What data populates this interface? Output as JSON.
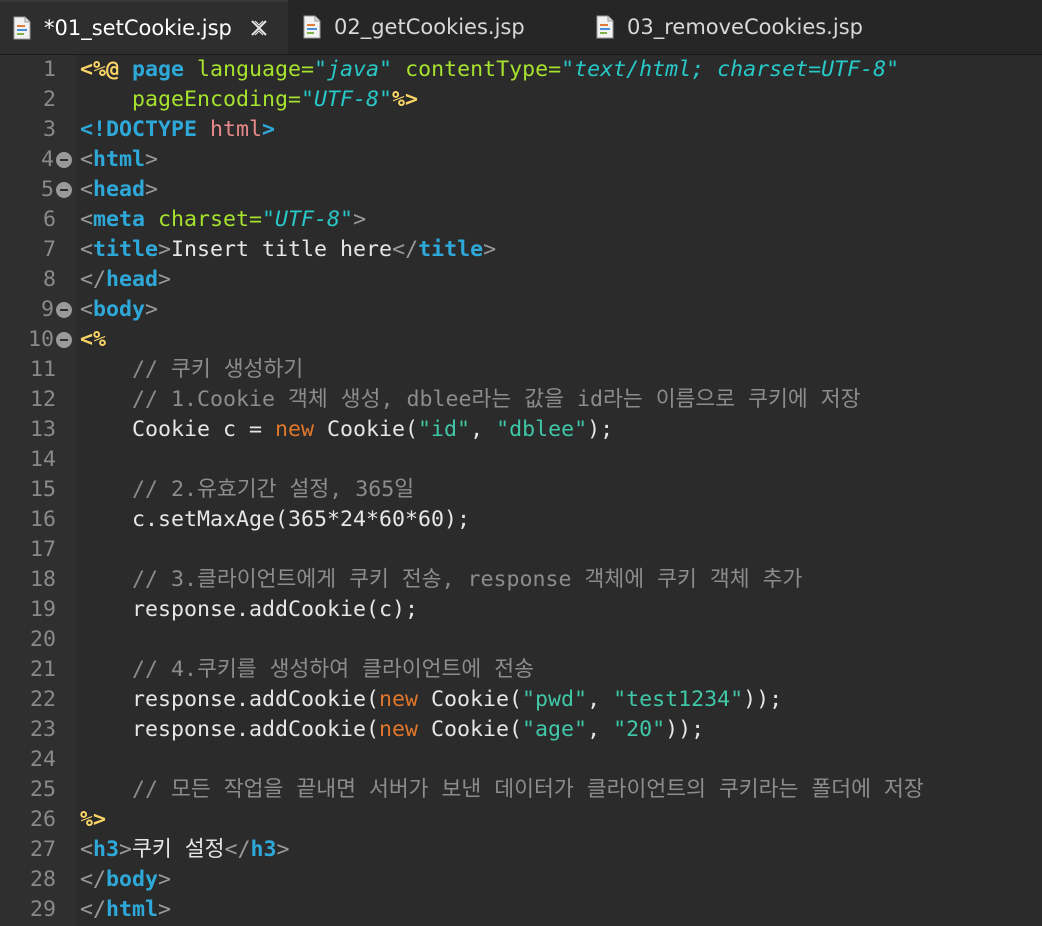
{
  "tabs": [
    {
      "label": "*01_setCookie.jsp",
      "active": true
    },
    {
      "label": "02_getCookies.jsp",
      "active": false
    },
    {
      "label": "03_removeCookies.jsp",
      "active": false
    }
  ],
  "line_numbers": [
    "1",
    "2",
    "3",
    "4",
    "5",
    "6",
    "7",
    "8",
    "9",
    "10",
    "11",
    "12",
    "13",
    "14",
    "15",
    "16",
    "17",
    "18",
    "19",
    "20",
    "21",
    "22",
    "23",
    "24",
    "25",
    "26",
    "27",
    "28",
    "29"
  ],
  "folded_lines": [
    4,
    5,
    9,
    10
  ],
  "code": [
    [
      [
        "delim",
        "<%@ "
      ],
      [
        "dirkw",
        "page "
      ],
      [
        "attr",
        "language="
      ],
      [
        "aval",
        "\"java\""
      ],
      [
        "attr",
        " contentType="
      ],
      [
        "aval",
        "\"text/html; charset=UTF-8\""
      ]
    ],
    [
      [
        "text",
        "    "
      ],
      [
        "attr",
        "pageEncoding="
      ],
      [
        "aval",
        "\"UTF-8\""
      ],
      [
        "delim",
        "%>"
      ]
    ],
    [
      [
        "doct",
        "<!DOCTYPE "
      ],
      [
        "docv",
        "html"
      ],
      [
        "doct",
        ">"
      ]
    ],
    [
      [
        "tagp",
        "<"
      ],
      [
        "tagn",
        "html"
      ],
      [
        "tagp",
        ">"
      ]
    ],
    [
      [
        "tagp",
        "<"
      ],
      [
        "tagn",
        "head"
      ],
      [
        "tagp",
        ">"
      ]
    ],
    [
      [
        "tagp",
        "<"
      ],
      [
        "tagn",
        "meta"
      ],
      [
        "attr",
        " charset="
      ],
      [
        "aval",
        "\"UTF-8\""
      ],
      [
        "tagp",
        ">"
      ]
    ],
    [
      [
        "tagp",
        "<"
      ],
      [
        "tagn",
        "title"
      ],
      [
        "tagp",
        ">"
      ],
      [
        "text",
        "Insert title here"
      ],
      [
        "tagp",
        "</"
      ],
      [
        "tagn",
        "title"
      ],
      [
        "tagp",
        ">"
      ]
    ],
    [
      [
        "tagp",
        "</"
      ],
      [
        "tagn",
        "head"
      ],
      [
        "tagp",
        ">"
      ]
    ],
    [
      [
        "tagp",
        "<"
      ],
      [
        "tagn",
        "body"
      ],
      [
        "tagp",
        ">"
      ]
    ],
    [
      [
        "delim",
        "<%"
      ]
    ],
    [
      [
        "text",
        "    "
      ],
      [
        "com",
        "// 쿠키 생성하기"
      ]
    ],
    [
      [
        "text",
        "    "
      ],
      [
        "com",
        "// 1.Cookie 객체 생성, dblee라는 값을 id라는 이름으로 쿠키에 저장"
      ]
    ],
    [
      [
        "text",
        "    Cookie c = "
      ],
      [
        "kw",
        "new"
      ],
      [
        "text",
        " Cookie("
      ],
      [
        "str",
        "\"id\""
      ],
      [
        "text",
        ", "
      ],
      [
        "str",
        "\"dblee\""
      ],
      [
        "text",
        ");"
      ]
    ],
    [],
    [
      [
        "text",
        "    "
      ],
      [
        "com",
        "// 2.유효기간 설정, 365일"
      ]
    ],
    [
      [
        "text",
        "    c.setMaxAge(365*24*60*60);"
      ]
    ],
    [],
    [
      [
        "text",
        "    "
      ],
      [
        "com",
        "// 3.클라이언트에게 쿠키 전송, response 객체에 쿠키 객체 추가"
      ]
    ],
    [
      [
        "text",
        "    response.addCookie(c);"
      ]
    ],
    [],
    [
      [
        "text",
        "    "
      ],
      [
        "com",
        "// 4.쿠키를 생성하여 클라이언트에 전송"
      ]
    ],
    [
      [
        "text",
        "    response.addCookie("
      ],
      [
        "kw",
        "new"
      ],
      [
        "text",
        " Cookie("
      ],
      [
        "str",
        "\"pwd\""
      ],
      [
        "text",
        ", "
      ],
      [
        "str",
        "\"test1234\""
      ],
      [
        "text",
        "));"
      ]
    ],
    [
      [
        "text",
        "    response.addCookie("
      ],
      [
        "kw",
        "new"
      ],
      [
        "text",
        " Cookie("
      ],
      [
        "str",
        "\"age\""
      ],
      [
        "text",
        ", "
      ],
      [
        "str",
        "\"20\""
      ],
      [
        "text",
        "));"
      ]
    ],
    [],
    [
      [
        "text",
        "    "
      ],
      [
        "com",
        "// 모든 작업을 끝내면 서버가 보낸 데이터가 클라이언트의 쿠키라는 폴더에 저장"
      ]
    ],
    [
      [
        "delim",
        "%>"
      ]
    ],
    [
      [
        "tagp",
        "<"
      ],
      [
        "tagn",
        "h3"
      ],
      [
        "tagp",
        ">"
      ],
      [
        "text",
        "쿠키 설정"
      ],
      [
        "tagp",
        "</"
      ],
      [
        "tagn",
        "h3"
      ],
      [
        "tagp",
        ">"
      ]
    ],
    [
      [
        "tagp",
        "</"
      ],
      [
        "tagn",
        "body"
      ],
      [
        "tagp",
        ">"
      ]
    ],
    [
      [
        "tagp",
        "</"
      ],
      [
        "tagn",
        "html"
      ],
      [
        "tagp",
        ">"
      ]
    ]
  ],
  "colors": {
    "background": "#2b2b2b",
    "delimiter": "#f9d466",
    "tag": "#2ea8d8",
    "attribute": "#a6e22e",
    "attribute_value": "#28c8c8",
    "comment": "#8c8c8c",
    "keyword": "#e0762a",
    "string": "#3fc7a8"
  },
  "icons": {
    "file": "jsp-file-icon",
    "close": "close-icon",
    "fold": "fold-minus-icon"
  }
}
